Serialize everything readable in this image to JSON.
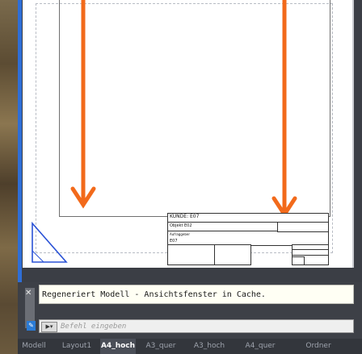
{
  "title_block": {
    "customer": "KUNDE: E07",
    "object": "Objekt E02",
    "field3": "Aufraggeber",
    "field4": "E07"
  },
  "command": {
    "history_line": "Regeneriert Modell - Ansichtsfenster in Cache.",
    "placeholder": "Befehl eingeben",
    "prompt_button": "▶▾",
    "close_glyph": "✕",
    "settings_glyph": "🔧"
  },
  "tabs": [
    {
      "label": "Modell",
      "active": false
    },
    {
      "label": "Layout1",
      "active": false
    },
    {
      "label": "A4_hoch",
      "active": true
    },
    {
      "label": "A3_quer",
      "active": false
    },
    {
      "label": "A3_hoch",
      "active": false
    },
    {
      "label": "A4_quer",
      "active": false
    },
    {
      "label": "Ordner",
      "active": false
    }
  ],
  "colors": {
    "accent_arrow": "#f26a1b",
    "ucs_blue": "#2a52d6",
    "active_tab": "#4a4e57"
  }
}
